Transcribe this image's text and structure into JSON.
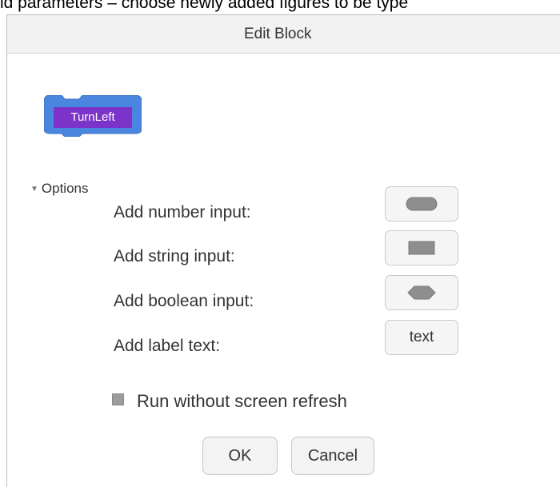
{
  "background_text": "ld parameters – choose newly added figures to be type",
  "dialog": {
    "title": "Edit Block",
    "block_label": "TurnLeft",
    "options_label": "Options",
    "inputs": [
      {
        "label": "Add number input:",
        "button_icon": "rounded-pill-icon"
      },
      {
        "label": "Add string input:",
        "button_icon": "rectangle-icon"
      },
      {
        "label": "Add boolean input:",
        "button_icon": "hexagon-icon"
      },
      {
        "label": "Add label text:",
        "button_text": "text"
      }
    ],
    "checkbox_label": "Run without screen refresh",
    "checkbox_checked": false,
    "ok_label": "OK",
    "cancel_label": "Cancel"
  },
  "colors": {
    "block_fill": "#4a86e0",
    "block_label_bg": "#7b33c9",
    "shape_gray": "#8e8e8e"
  }
}
